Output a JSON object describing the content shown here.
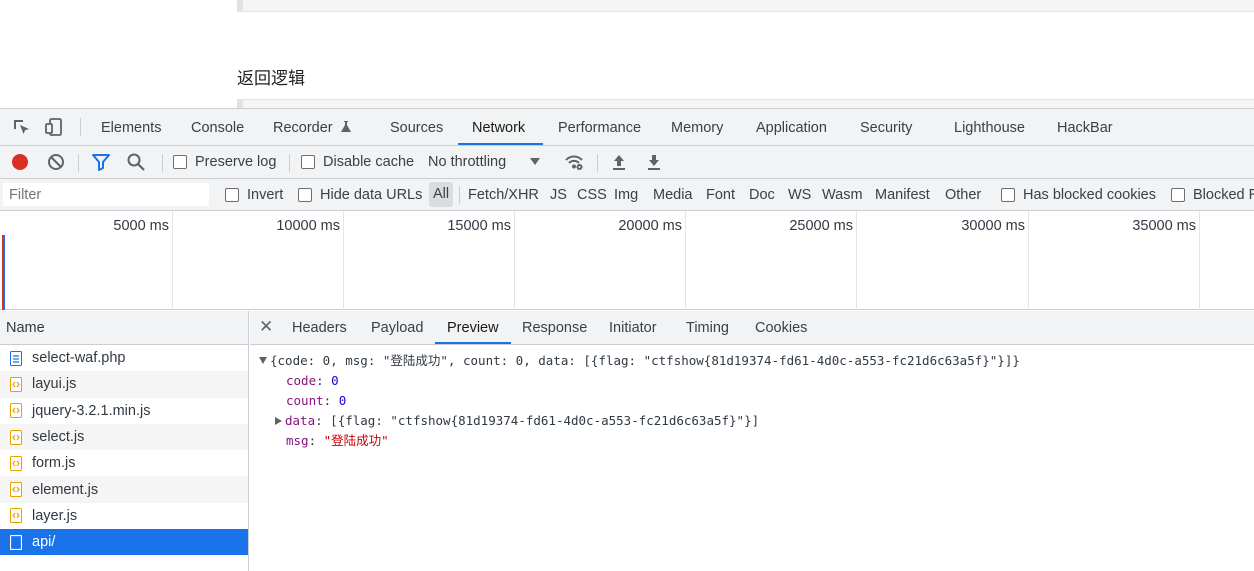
{
  "page": {
    "heading": "返回逻辑"
  },
  "devtools": {
    "panel_tabs": [
      {
        "label": "Elements"
      },
      {
        "label": "Console"
      },
      {
        "label": "Recorder"
      },
      {
        "label": "Sources"
      },
      {
        "label": "Network",
        "active": true
      },
      {
        "label": "Performance"
      },
      {
        "label": "Memory"
      },
      {
        "label": "Application"
      },
      {
        "label": "Security"
      },
      {
        "label": "Lighthouse"
      },
      {
        "label": "HackBar"
      }
    ],
    "toolbar": {
      "preserve_log": "Preserve log",
      "disable_cache": "Disable cache",
      "throttling": "No throttling"
    },
    "filter": {
      "placeholder": "Filter",
      "invert": "Invert",
      "hide_data_urls": "Hide data URLs",
      "types": [
        "All",
        "Fetch/XHR",
        "JS",
        "CSS",
        "Img",
        "Media",
        "Font",
        "Doc",
        "WS",
        "Wasm",
        "Manifest",
        "Other"
      ],
      "has_blocked_cookies": "Has blocked cookies",
      "blocked_requests": "Blocked R"
    },
    "overview_ticks": [
      "5000 ms",
      "10000 ms",
      "15000 ms",
      "20000 ms",
      "25000 ms",
      "30000 ms",
      "35000 ms"
    ],
    "requests": {
      "header": "Name",
      "items": [
        {
          "name": "select-waf.php",
          "type": "doc"
        },
        {
          "name": "layui.js",
          "type": "script"
        },
        {
          "name": "jquery-3.2.1.min.js",
          "type": "script"
        },
        {
          "name": "select.js",
          "type": "script"
        },
        {
          "name": "form.js",
          "type": "script"
        },
        {
          "name": "element.js",
          "type": "script"
        },
        {
          "name": "layer.js",
          "type": "script"
        },
        {
          "name": "api/",
          "type": "fetch",
          "selected": true
        }
      ]
    },
    "detail_tabs": [
      {
        "label": "Headers"
      },
      {
        "label": "Payload"
      },
      {
        "label": "Preview",
        "active": true
      },
      {
        "label": "Response"
      },
      {
        "label": "Initiator"
      },
      {
        "label": "Timing"
      },
      {
        "label": "Cookies"
      }
    ],
    "preview": {
      "summary": "{code: 0, msg: \"登陆成功\", count: 0, data: [{flag: \"ctfshow{81d19374-fd61-4d0c-a553-fc21d6c63a5f}\"}]}",
      "code_key": "code",
      "code_val": "0",
      "count_key": "count",
      "count_val": "0",
      "data_key": "data",
      "data_val": "[{flag: \"ctfshow{81d19374-fd61-4d0c-a553-fc21d6c63a5f}\"}]",
      "msg_key": "msg",
      "msg_val": "\"登陆成功\""
    }
  }
}
